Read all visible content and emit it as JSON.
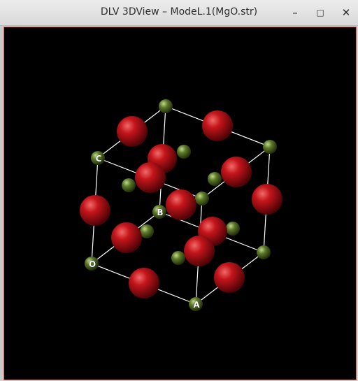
{
  "window": {
    "title": "DLV 3DView – ModeL.1(MgO.str)",
    "minimize_glyph": "–",
    "maximize_glyph": "□",
    "close_glyph": "✕"
  },
  "scene": {
    "axis_labels": {
      "c": "C",
      "b": "B",
      "origin": "O",
      "a": "A"
    },
    "colors": {
      "oxygen": "#c4151a",
      "magnesium": "#5b7a28",
      "bonds": "#ffffff",
      "background": "#000000"
    }
  }
}
